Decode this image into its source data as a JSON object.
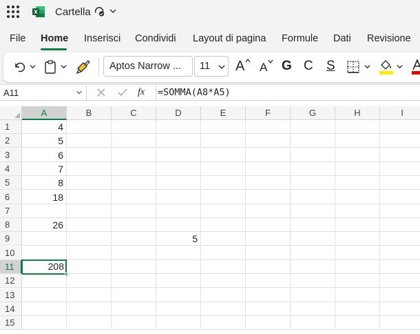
{
  "app": {
    "title": "Cartella"
  },
  "tabs": [
    {
      "label": "File"
    },
    {
      "label": "Home"
    },
    {
      "label": "Inserisci"
    },
    {
      "label": "Condividi"
    },
    {
      "label": "Layout di pagina"
    },
    {
      "label": "Formule"
    },
    {
      "label": "Dati"
    },
    {
      "label": "Revisione"
    }
  ],
  "ribbon": {
    "font_name": "Aptos Narrow ...",
    "font_size": "11",
    "bold_label": "G",
    "italic_label": "C",
    "underline_label": "S",
    "increase_font_label": "A",
    "decrease_font_label": "A"
  },
  "formula_bar": {
    "name_box": "A11",
    "fx_label": "fx",
    "formula": "=SOMMA(A8*A5)"
  },
  "sheet": {
    "columns": [
      "A",
      "B",
      "C",
      "D",
      "E",
      "F",
      "G",
      "H",
      "I"
    ],
    "rows": [
      "1",
      "2",
      "3",
      "4",
      "5",
      "6",
      "7",
      "8",
      "9",
      "10",
      "11",
      "12",
      "13",
      "14",
      "15"
    ],
    "selected_column": "A",
    "selected_row": "11",
    "cells": {
      "A1": "4",
      "A2": "5",
      "A3": "6",
      "A4": "7",
      "A5": "8",
      "A6": "18",
      "A8": "26",
      "D9": "5",
      "A11": "208"
    }
  },
  "colors": {
    "accent": "#107c41",
    "fill_color": "#ffeb00",
    "font_color": "#e00000"
  }
}
